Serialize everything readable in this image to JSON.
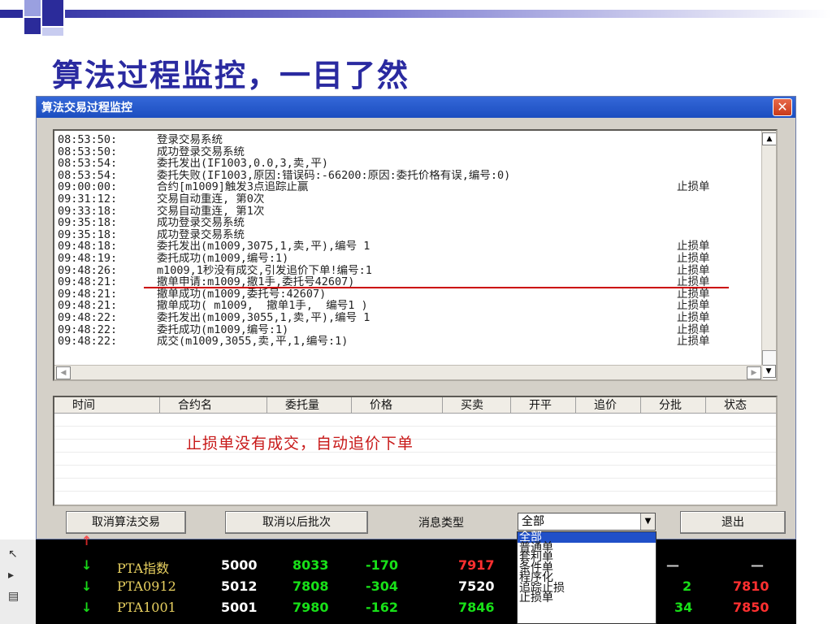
{
  "slide": {
    "title": "算法过程监控，一目了然"
  },
  "dialog": {
    "title": "算法交易过程监控",
    "close": "✕",
    "log": [
      {
        "time": "08:53:50:",
        "msg": "登录交易系统",
        "tag": ""
      },
      {
        "time": "08:53:50:",
        "msg": "成功登录交易系统",
        "tag": ""
      },
      {
        "time": "08:53:54:",
        "msg": "委托发出(IF1003,0.0,3,卖,平)",
        "tag": ""
      },
      {
        "time": "08:53:54:",
        "msg": "委托失败(IF1003,原因:错误码:-66200:原因:委托价格有误,编号:0)",
        "tag": ""
      },
      {
        "time": "09:00:00:",
        "msg": "合约[m1009]触发3点追踪止赢",
        "tag": "止损单"
      },
      {
        "time": "09:31:12:",
        "msg": "交易自动重连, 第0次",
        "tag": ""
      },
      {
        "time": "09:33:18:",
        "msg": "交易自动重连, 第1次",
        "tag": ""
      },
      {
        "time": "09:35:18:",
        "msg": "成功登录交易系统",
        "tag": ""
      },
      {
        "time": "09:35:18:",
        "msg": "成功登录交易系统",
        "tag": ""
      },
      {
        "time": "09:48:18:",
        "msg": "委托发出(m1009,3075,1,卖,平),编号 1",
        "tag": "止损单"
      },
      {
        "time": "09:48:19:",
        "msg": "委托成功(m1009,编号:1)",
        "tag": "止损单"
      },
      {
        "time": "09:48:26:",
        "msg": "m1009,1秒没有成交,引发追价下单!编号:1",
        "tag": "止损单"
      },
      {
        "time": "09:48:21:",
        "msg": "撤单申请:m1009,撤1手,委托号42607)",
        "tag": "止损单"
      },
      {
        "time": "09:48:21:",
        "msg": "撤单成功(m1009,委托号:42607)",
        "tag": "止损单"
      },
      {
        "time": "09:48:21:",
        "msg": "撤单成功( m1009,  撤单1手,  编号1 )",
        "tag": "止损单"
      },
      {
        "time": "09:48:22:",
        "msg": "委托发出(m1009,3055,1,卖,平),编号 1",
        "tag": "止损单"
      },
      {
        "time": "09:48:22:",
        "msg": "委托成功(m1009,编号:1)",
        "tag": "止损单"
      },
      {
        "time": "09:48:22:",
        "msg": "成交(m1009,3055,卖,平,1,编号:1)",
        "tag": "止损单"
      }
    ],
    "table": {
      "columns": [
        "时间",
        "合约名",
        "委托量",
        "价格",
        "买卖",
        "开平",
        "追价",
        "分批",
        "状态"
      ],
      "annotation": "止损单没有成交，自动追价下单"
    },
    "buttons": {
      "cancel_algo": "取消算法交易",
      "cancel_batches": "取消以后批次",
      "exit": "退出"
    },
    "msg_type": {
      "label": "消息类型",
      "selected": "全部",
      "options": [
        "全部",
        "普通单",
        "套利单",
        "条件单",
        "程序化",
        "追踪止损",
        "止损单"
      ]
    }
  },
  "market": {
    "rows": [
      {
        "name": "PTA指数",
        "vol": "5000",
        "last": "8033",
        "chg": "-170",
        "bid": "7917",
        "c1": "—",
        "c2": "—"
      },
      {
        "name": "PTA0912",
        "vol": "5012",
        "last": "7808",
        "chg": "-304",
        "bid": "7520",
        "c1": "2",
        "c2": "7810"
      },
      {
        "name": "PTA1001",
        "vol": "5001",
        "last": "7980",
        "chg": "-162",
        "bid": "7846",
        "c1": "34",
        "c2": "7850"
      }
    ]
  }
}
